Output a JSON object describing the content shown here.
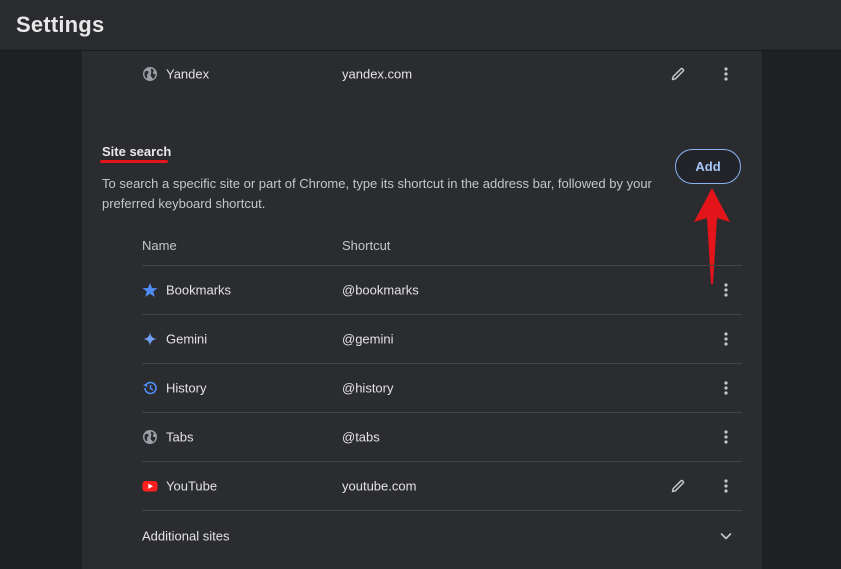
{
  "header": {
    "title": "Settings"
  },
  "top_engine": {
    "name": "Yandex",
    "shortcut": "yandex.com",
    "icon": "globe-icon"
  },
  "site_search": {
    "title": "Site search",
    "description": "To search a specific site or part of Chrome, type its shortcut in the address bar, followed by your preferred keyboard shortcut.",
    "add_label": "Add",
    "columns": {
      "name": "Name",
      "shortcut": "Shortcut"
    },
    "rows": [
      {
        "name": "Bookmarks",
        "shortcut": "@bookmarks",
        "icon": "star-icon"
      },
      {
        "name": "Gemini",
        "shortcut": "@gemini",
        "icon": "sparkle-icon"
      },
      {
        "name": "History",
        "shortcut": "@history",
        "icon": "history-icon"
      },
      {
        "name": "Tabs",
        "shortcut": "@tabs",
        "icon": "globe-icon"
      },
      {
        "name": "YouTube",
        "shortcut": "youtube.com",
        "icon": "youtube-icon"
      }
    ],
    "additional_label": "Additional sites"
  },
  "colors": {
    "accent": "#a8c7fa",
    "annotation": "#e4141b",
    "background": "#1f2023",
    "panel": "#2b2c2f"
  }
}
